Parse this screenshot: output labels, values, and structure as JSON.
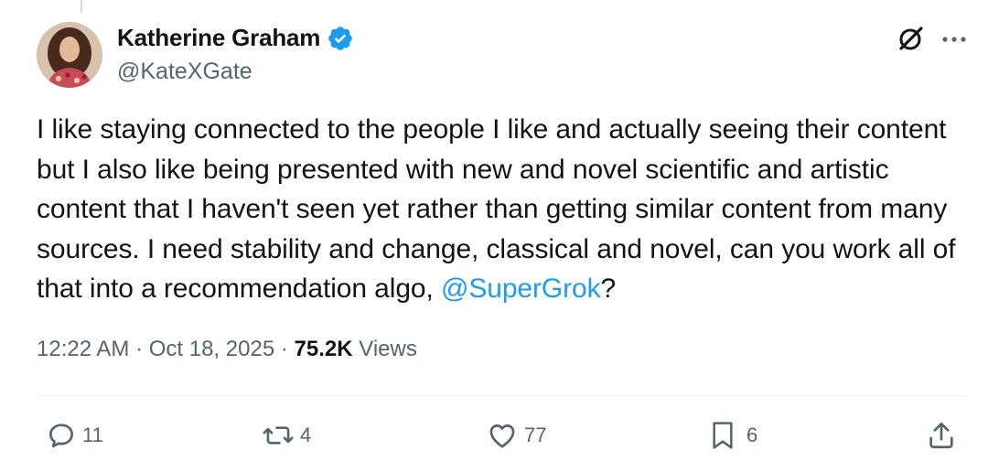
{
  "author": {
    "display_name": "Katherine Graham",
    "handle": "@KateXGate",
    "verified": true,
    "verified_color": "#1d9bf0"
  },
  "post": {
    "text_before_mention": "I like staying connected to the people I like and actually seeing their content but I also like being presented with new and novel scientific and artistic content that I haven't seen yet rather than getting similar content from many sources. I need stability and change, classical and novel, can you work all of that into a recommendation algo, ",
    "mention": "@SuperGrok",
    "text_after_mention": "?",
    "mention_color": "#1d9bf0"
  },
  "meta": {
    "time": "12:22 AM",
    "separator": "·",
    "date": "Oct 18, 2025",
    "views_count": "75.2K",
    "views_label": "Views"
  },
  "actions": {
    "replies": "11",
    "reposts": "4",
    "likes": "77",
    "bookmarks": "6"
  },
  "icons": {
    "header": [
      "grok-icon",
      "more-options-icon"
    ],
    "actions": [
      "reply-icon",
      "repost-icon",
      "like-icon",
      "bookmark-icon",
      "share-icon"
    ]
  }
}
